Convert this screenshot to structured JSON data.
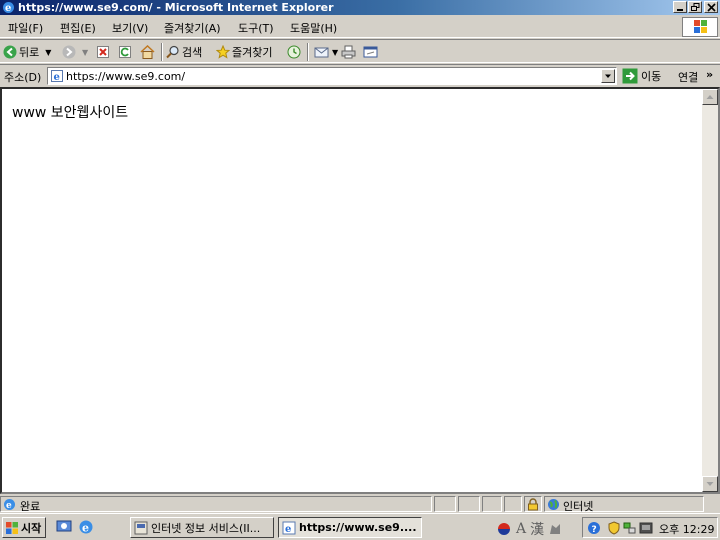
{
  "window": {
    "title": "https://www.se9.com/ - Microsoft Internet Explorer"
  },
  "menu": {
    "items": [
      "파일(F)",
      "편집(E)",
      "보기(V)",
      "즐겨찾기(A)",
      "도구(T)",
      "도움말(H)"
    ]
  },
  "toolbar": {
    "back_label": "뒤로",
    "search_label": "검색",
    "favorites_label": "즐겨찾기"
  },
  "address": {
    "label": "주소(D)",
    "url": "https://www.se9.com/",
    "go_label": "이동",
    "links_label": "연결"
  },
  "page": {
    "text": "www 보안웹사이트"
  },
  "status": {
    "text": "완료",
    "zone": "인터넷"
  },
  "taskbar": {
    "start_label": "시작",
    "tasks": [
      "인터넷 정보 서비스(II...",
      "https://www.se9...."
    ],
    "clock": "오후 12:29"
  },
  "colors": {
    "title_start": "#0a246a",
    "title_end": "#a6caf0",
    "chrome": "#d4d0c8"
  }
}
